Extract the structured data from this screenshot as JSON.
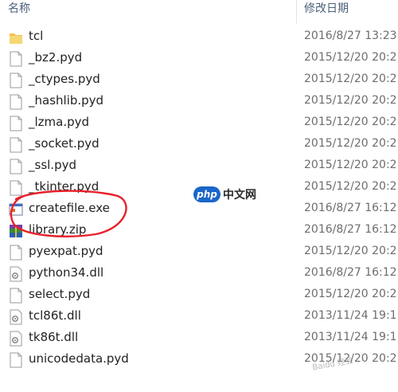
{
  "header": {
    "name_label": "名称",
    "date_label": "修改日期"
  },
  "files": [
    {
      "name": "tcl",
      "date": "2016/8/27 13:23",
      "icon": "folder-icon"
    },
    {
      "name": "_bz2.pyd",
      "date": "2015/12/20 20:2",
      "icon": "file-icon"
    },
    {
      "name": "_ctypes.pyd",
      "date": "2015/12/20 20:2",
      "icon": "file-icon"
    },
    {
      "name": "_hashlib.pyd",
      "date": "2015/12/20 20:2",
      "icon": "file-icon"
    },
    {
      "name": "_lzma.pyd",
      "date": "2015/12/20 20:2",
      "icon": "file-icon"
    },
    {
      "name": "_socket.pyd",
      "date": "2015/12/20 20:2",
      "icon": "file-icon"
    },
    {
      "name": "_ssl.pyd",
      "date": "2015/12/20 20:2",
      "icon": "file-icon"
    },
    {
      "name": "_tkinter.pyd",
      "date": "2015/12/20 20:2",
      "icon": "file-icon"
    },
    {
      "name": "createfile.exe",
      "date": "2016/8/27 16:12",
      "icon": "exe-icon"
    },
    {
      "name": "library.zip",
      "date": "2016/8/27 16:12",
      "icon": "zip-icon"
    },
    {
      "name": "pyexpat.pyd",
      "date": "2015/12/20 20:2",
      "icon": "file-icon"
    },
    {
      "name": "python34.dll",
      "date": "2016/8/27 16:12",
      "icon": "dll-icon"
    },
    {
      "name": "select.pyd",
      "date": "2015/12/20 20:2",
      "icon": "file-icon"
    },
    {
      "name": "tcl86t.dll",
      "date": "2013/11/24 19:1",
      "icon": "dll-icon"
    },
    {
      "name": "tk86t.dll",
      "date": "2013/11/24 19:1",
      "icon": "dll-icon"
    },
    {
      "name": "unicodedata.pyd",
      "date": "2015/12/20 20:2",
      "icon": "file-icon"
    }
  ],
  "overlay": {
    "logo_badge": "php",
    "logo_text": "中文网",
    "watermark": "Baidu 经验"
  },
  "colors": {
    "annotation": "#e8202a",
    "header_text": "#4c607a",
    "folder": "#f2c14e"
  }
}
